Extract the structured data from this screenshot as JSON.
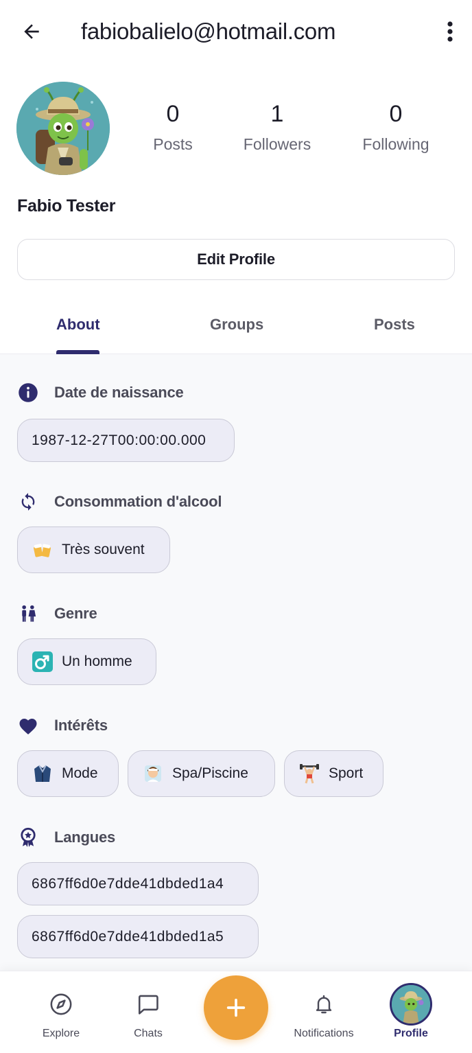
{
  "header": {
    "title": "fabiobalielo@hotmail.com"
  },
  "profile": {
    "name": "Fabio Tester",
    "stats": {
      "posts_count": "0",
      "posts_label": "Posts",
      "followers_count": "1",
      "followers_label": "Followers",
      "following_count": "0",
      "following_label": "Following"
    },
    "edit_button": "Edit Profile"
  },
  "tabs": [
    {
      "label": "About",
      "active": true
    },
    {
      "label": "Groups",
      "active": false
    },
    {
      "label": "Posts",
      "active": false
    }
  ],
  "about": {
    "birth": {
      "title": "Date de naissance",
      "icon": "info-icon",
      "value": "1987-12-27T00:00:00.000"
    },
    "alcohol": {
      "title": "Consommation d'alcool",
      "icon": "repeat-icon",
      "value": "Très souvent",
      "emoji": "beer-mugs-icon"
    },
    "gender": {
      "title": "Genre",
      "icon": "people-icon",
      "value": "Un homme",
      "emoji": "male-sign-icon"
    },
    "interests": {
      "title": "Intérêts",
      "icon": "heart-icon",
      "items": [
        {
          "label": "Mode",
          "emoji": "coat-icon"
        },
        {
          "label": "Spa/Piscine",
          "emoji": "spa-person-icon"
        },
        {
          "label": "Sport",
          "emoji": "weightlifter-icon"
        }
      ]
    },
    "languages": {
      "title": "Langues",
      "icon": "award-icon",
      "items": [
        "6867ff6d0e7dde41dbded1a4",
        "6867ff6d0e7dde41dbded1a5"
      ]
    }
  },
  "bottom_nav": {
    "explore": "Explore",
    "chats": "Chats",
    "notifications": "Notifications",
    "profile": "Profile"
  },
  "colors": {
    "accent": "#2f2c6e",
    "fab": "#eea13a",
    "chip_bg": "#ececf6",
    "content_bg": "#f8f9fb"
  }
}
